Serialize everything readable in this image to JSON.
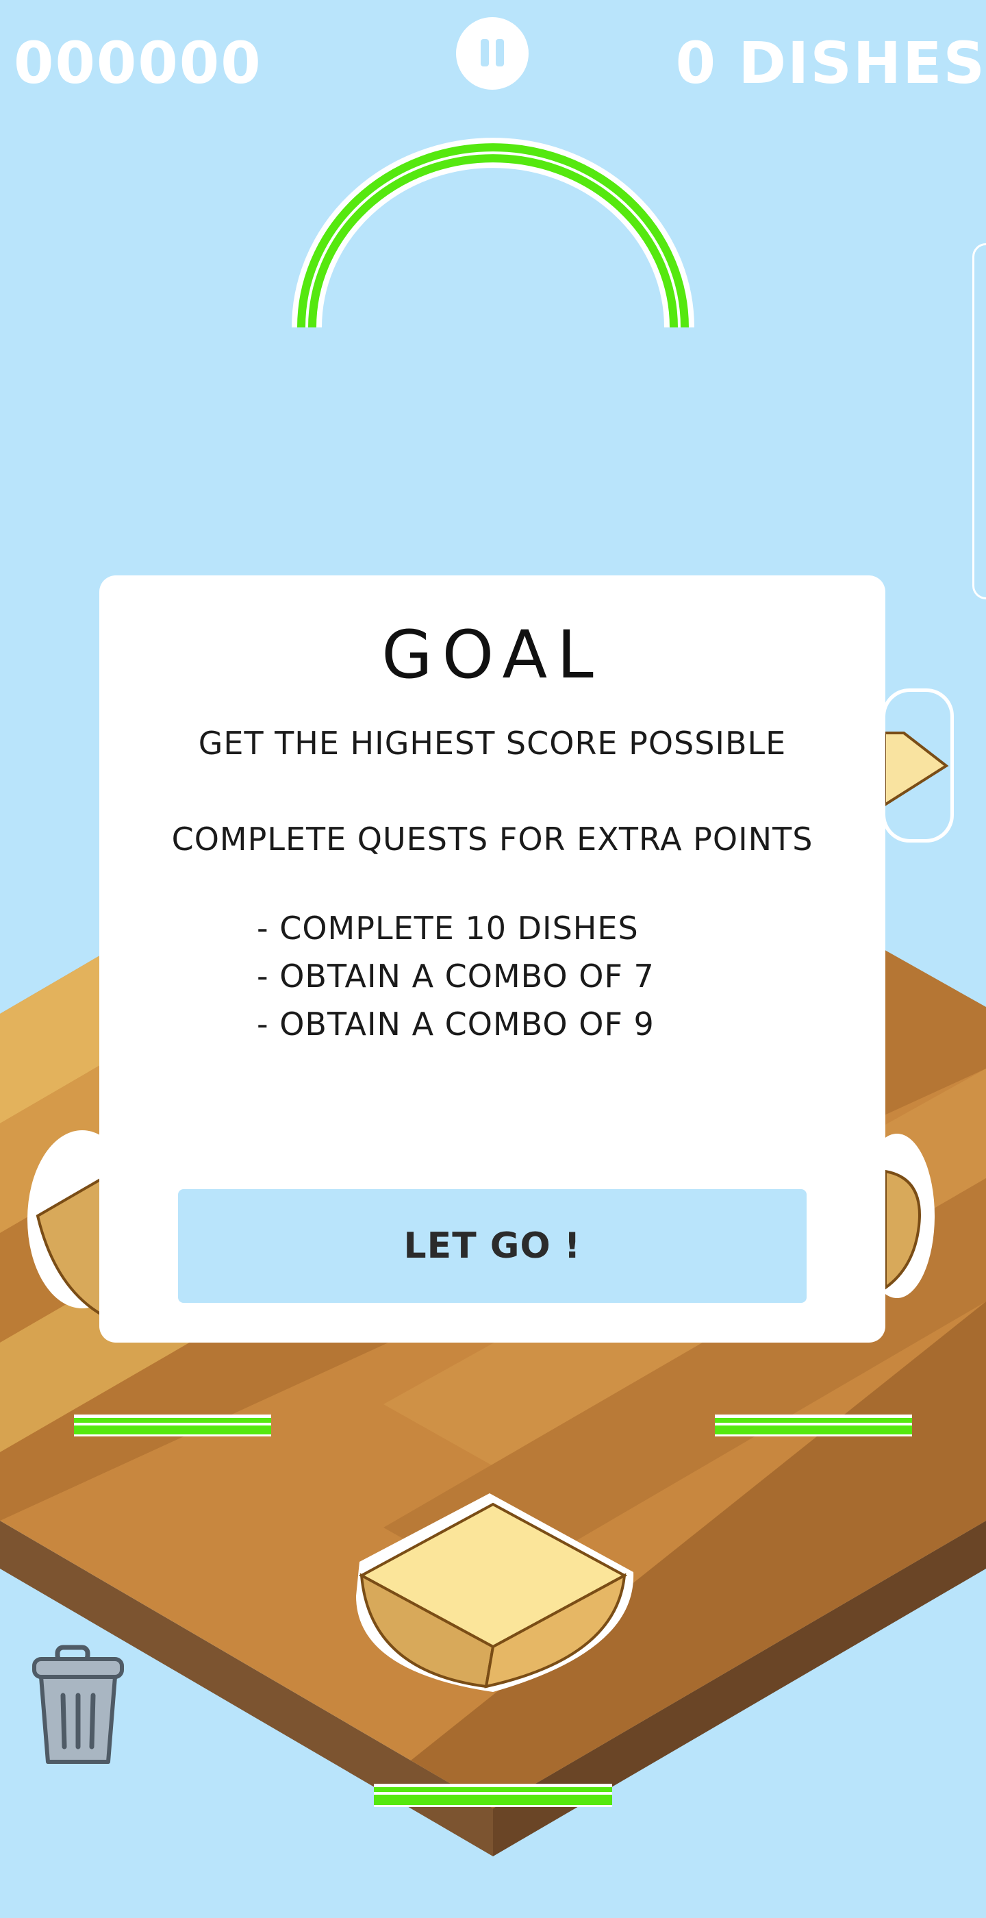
{
  "hud": {
    "score": "000000",
    "dishes": "0 DISHES"
  },
  "icons": {
    "pause": "pause-icon",
    "trash": "trash-can-icon"
  },
  "colors": {
    "background": "#b9e4fb",
    "accent_green": "#55e80f",
    "button_bg": "#b9e4fb"
  },
  "modal": {
    "title": "GOAL",
    "line1": "GET THE HIGHEST SCORE POSSIBLE",
    "line2": "COMPLETE QUESTS FOR EXTRA POINTS",
    "quests": [
      "- COMPLETE 10 DISHES",
      "- OBTAIN A COMBO OF 7",
      "- OBTAIN A COMBO OF 9"
    ],
    "button_label": "LET GO !"
  }
}
